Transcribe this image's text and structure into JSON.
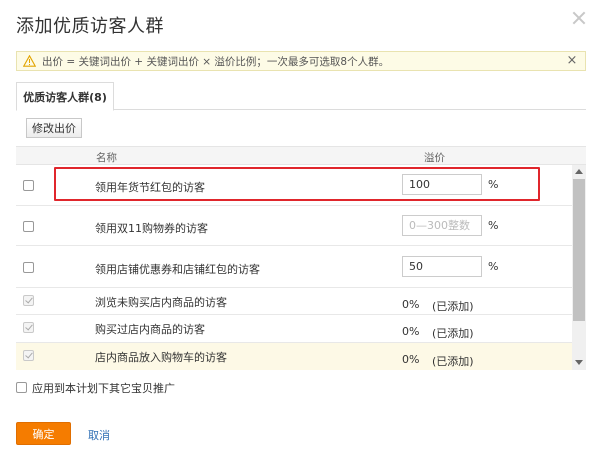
{
  "dialog": {
    "title": "添加优质访客人群"
  },
  "notice": {
    "text": "出价 = 关键词出价 + 关键词出价 × 溢价比例；一次最多可选取8个人群。",
    "close_label": "×"
  },
  "tabs": [
    {
      "label": "优质访客人群(8)",
      "active": true
    }
  ],
  "toolbar": {
    "edit_label": "修改出价"
  },
  "table": {
    "columns": {
      "name": "名称",
      "premium": "溢价"
    },
    "rows": [
      {
        "name": "领用年货节红包的访客",
        "state": "input",
        "value": "100",
        "placeholder": "",
        "percent": "%",
        "checked": false
      },
      {
        "name": "领用双11购物券的访客",
        "state": "input",
        "value": "",
        "placeholder": "0—300整数",
        "percent": "%",
        "checked": false
      },
      {
        "name": "领用店铺优惠券和店铺红包的访客",
        "state": "input",
        "value": "50",
        "placeholder": "",
        "percent": "%",
        "checked": false
      },
      {
        "name": "浏览未购买店内商品的访客",
        "state": "added",
        "premium_text": "0%",
        "added_text": "(已添加)",
        "checked": true
      },
      {
        "name": "购买过店内商品的访客",
        "state": "added",
        "premium_text": "0%",
        "added_text": "(已添加)",
        "checked": true
      },
      {
        "name": "店内商品放入购物车的访客",
        "state": "added",
        "premium_text": "0%",
        "added_text": "(已添加)",
        "checked": true
      }
    ]
  },
  "footer": {
    "apply_label": "应用到本计划下其它宝贝推广",
    "confirm_label": "确定",
    "cancel_label": "取消"
  },
  "colors": {
    "confirm_bg": "#f57c00",
    "highlight_border": "#e0262c",
    "cancel_link": "#2f6fb5",
    "notice_bg": "#fdfbe6"
  }
}
